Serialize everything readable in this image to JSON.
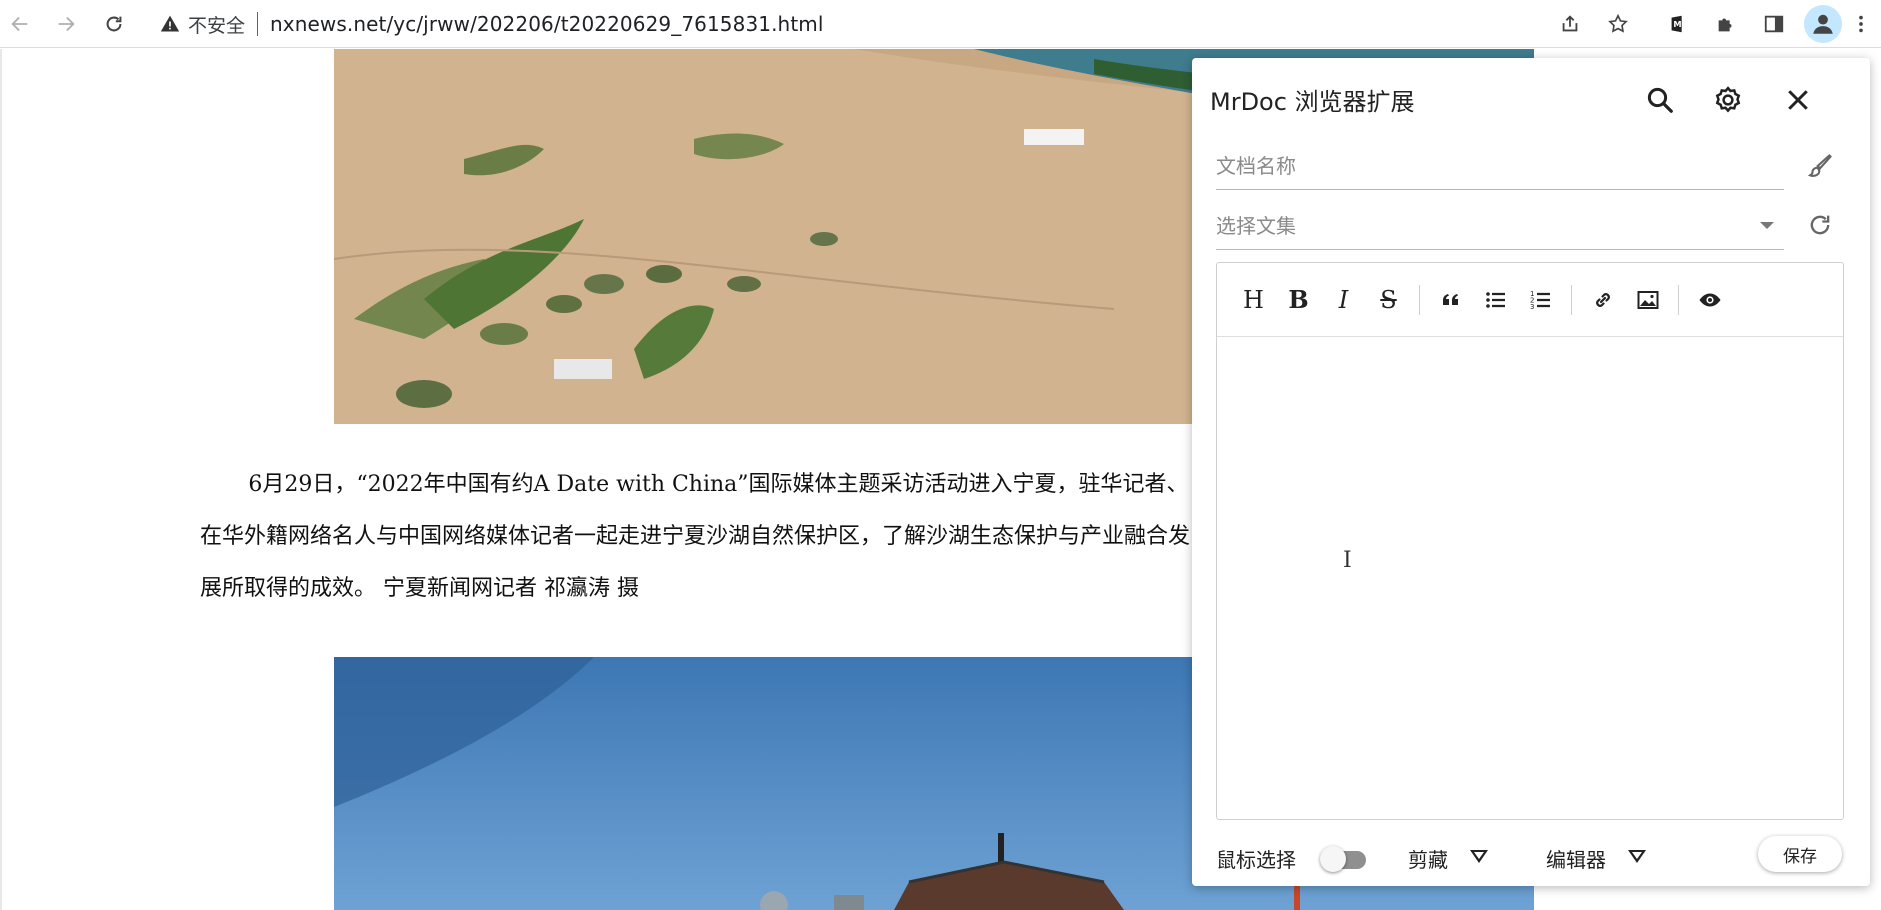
{
  "browser": {
    "security_label": "不安全",
    "url": "nxnews.net/yc/jrww/202206/t20220629_7615831.html",
    "icons": [
      "back-icon",
      "forward-icon",
      "reload-icon",
      "warning-icon",
      "share-icon",
      "star-icon",
      "mrdoc-extension-icon",
      "puzzle-icon",
      "side-panel-icon",
      "profile-icon",
      "more-icon"
    ]
  },
  "article": {
    "paragraph": "6月29日，“2022年中国有约A  Date  with  China”国际媒体主题采访活动进入宁夏，驻华记者、在华外籍网络名人与中国网络媒体记者一起走进宁夏沙湖自然保护区，了解沙湖生态保护与产业融合发展所取得的成效。  宁夏新闻网记者  祁瀛涛  摄"
  },
  "extension": {
    "title": "MrDoc 浏览器扩展",
    "doc_name_placeholder": "文档名称",
    "collection_placeholder": "选择文集",
    "editor_tools": [
      "H",
      "B",
      "I",
      "S"
    ],
    "footer": {
      "mouse_select_label": "鼠标选择",
      "clip_label": "剪藏",
      "editor_label": "编辑器",
      "save_label": "保存"
    }
  }
}
